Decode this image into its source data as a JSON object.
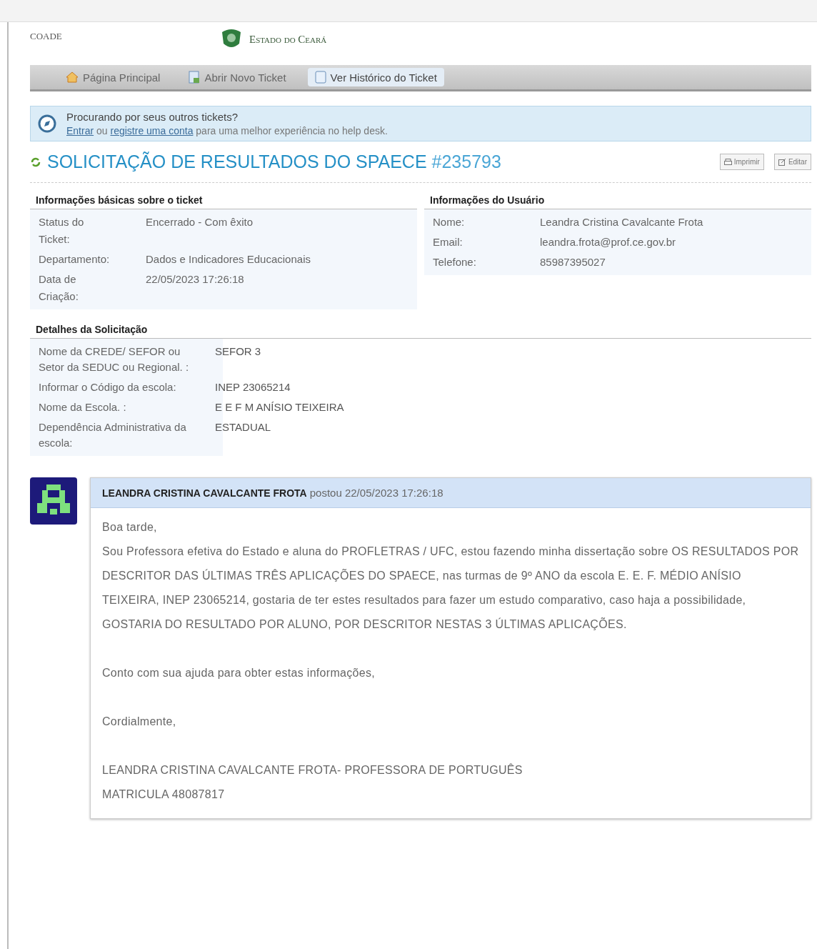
{
  "header": {
    "department": "COADE",
    "logo_title": "Estado do Ceará"
  },
  "nav": [
    {
      "label": "Página Principal",
      "kind": "home",
      "selected": false
    },
    {
      "label": "Abrir Novo Ticket",
      "kind": "new",
      "selected": false
    },
    {
      "label": "Ver Histórico do Ticket",
      "kind": "doc",
      "selected": true
    }
  ],
  "notice": {
    "title": "Procurando por seus outros tickets?",
    "login_link": "Entrar",
    "middle": "ou",
    "register_link": "registre uma conta",
    "rest": "para uma melhor experiência no help desk."
  },
  "ticket": {
    "title": "SOLICITAÇÃO DE RESULTADOS DO SPAECE",
    "number": "#235793",
    "actions": [
      {
        "label": "Imprimir",
        "kind": "print"
      },
      {
        "label": "Editar",
        "kind": "edit"
      }
    ]
  },
  "basic_info": {
    "heading": "Informações básicas sobre o ticket",
    "rows": [
      {
        "label": "Status do Ticket:",
        "value": "Encerrado - Com êxito"
      },
      {
        "label": "Departamento:",
        "value": "Dados e Indicadores Educacionais"
      },
      {
        "label": "Data de Criação:",
        "value": "22/05/2023 17:26:18"
      }
    ]
  },
  "user_info": {
    "heading": "Informações do Usuário",
    "rows": [
      {
        "label": "Nome:",
        "value": "Leandra Cristina Cavalcante Frota"
      },
      {
        "label": "Email:",
        "value": "leandra.frota@prof.ce.gov.br"
      },
      {
        "label": "Telefone:",
        "value": "85987395027"
      }
    ]
  },
  "details": {
    "heading": "Detalhes da Solicitação",
    "rows": [
      {
        "label": "Nome da CREDE/ SEFOR ou Setor da SEDUC ou Regional. :",
        "value": "SEFOR 3"
      },
      {
        "label": "Informar o Código da escola:",
        "value": "INEP 23065214"
      },
      {
        "label": "Nome da Escola. :",
        "value": "E E F M ANÍSIO TEIXEIRA"
      },
      {
        "label": "Dependência Administrativa da escola:",
        "value": "ESTADUAL"
      }
    ]
  },
  "message": {
    "author": "LEANDRA CRISTINA CAVALCANTE FROTA",
    "posted": "postou 22/05/2023 17:26:18",
    "paragraphs": [
      [
        "Boa tarde,",
        "Sou Professora efetiva do Estado e aluna do PROFLETRAS / UFC, estou fazendo minha dissertação sobre OS RESULTADOS POR DESCRITOR DAS ÚLTIMAS TRÊS APLICAÇÕES DO SPAECE, nas turmas de 9º ANO da escola E. E. F. MÉDIO ANÍSIO TEIXEIRA, INEP 23065214, gostaria de ter estes resultados para fazer um estudo comparativo, caso haja a possibilidade, GOSTARIA DO RESULTADO POR ALUNO, POR DESCRITOR NESTAS 3 ÚLTIMAS APLICAÇÕES."
      ],
      [
        "Conto com sua ajuda para obter estas informações,"
      ],
      [
        "Cordialmente,"
      ],
      [
        "LEANDRA CRISTINA CAVALCANTE FROTA- PROFESSORA DE PORTUGUÊS",
        "MATRICULA 48087817"
      ]
    ]
  }
}
